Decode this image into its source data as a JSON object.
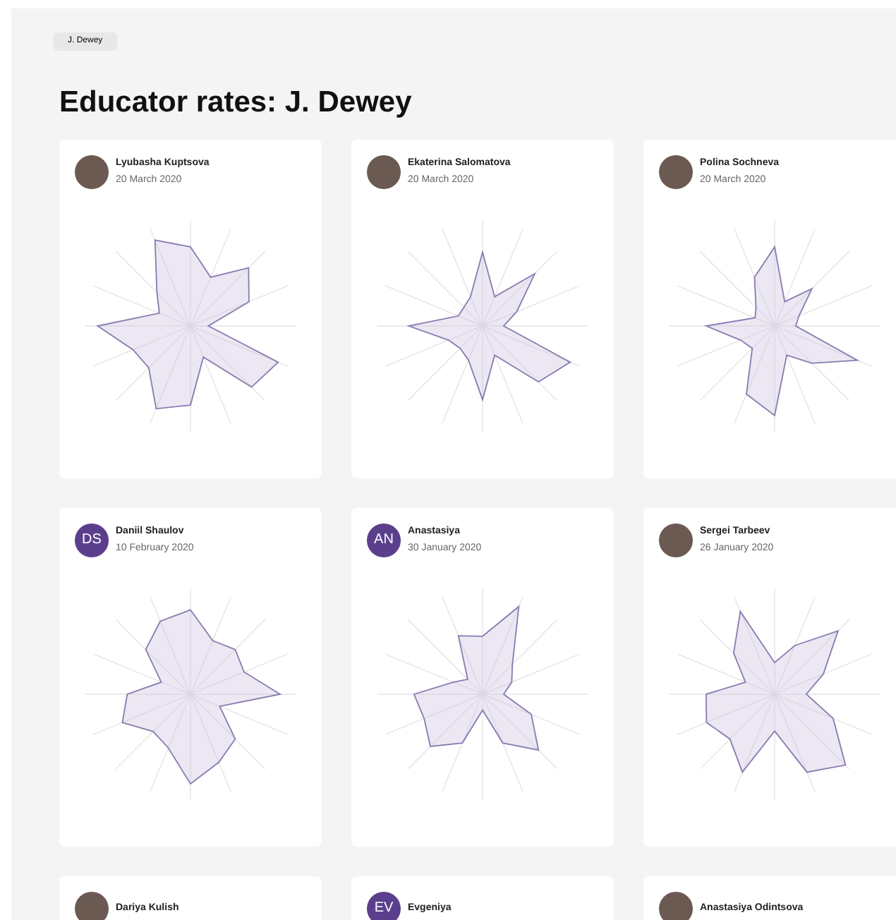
{
  "breadcrumb": "J. Dewey",
  "title": "Educator rates: J. Dewey",
  "cards": [
    {
      "name": "Lyubasha Kuptsova",
      "date": "20 March 2020",
      "avatar": {
        "kind": "photo"
      }
    },
    {
      "name": "Ekaterina Salomatova",
      "date": "20 March 2020",
      "avatar": {
        "kind": "photo"
      }
    },
    {
      "name": "Polina Sochneva",
      "date": "20 March 2020",
      "avatar": {
        "kind": "photo"
      }
    },
    {
      "name": "Daniil Shaulov",
      "date": "10 February 2020",
      "avatar": {
        "kind": "initials",
        "initials": "DS"
      }
    },
    {
      "name": "Anastasiya",
      "date": "30 January 2020",
      "avatar": {
        "kind": "initials",
        "initials": "AN"
      }
    },
    {
      "name": "Sergei Tarbeev",
      "date": "26 January 2020",
      "avatar": {
        "kind": "photo"
      }
    },
    {
      "name": "Dariya Kulish",
      "avatar": {
        "kind": "photo"
      }
    },
    {
      "name": "Evgeniya",
      "avatar": {
        "kind": "initials",
        "initials": "EV"
      }
    },
    {
      "name": "Anastasiya Odintsova",
      "avatar": {
        "kind": "photo"
      }
    }
  ]
}
